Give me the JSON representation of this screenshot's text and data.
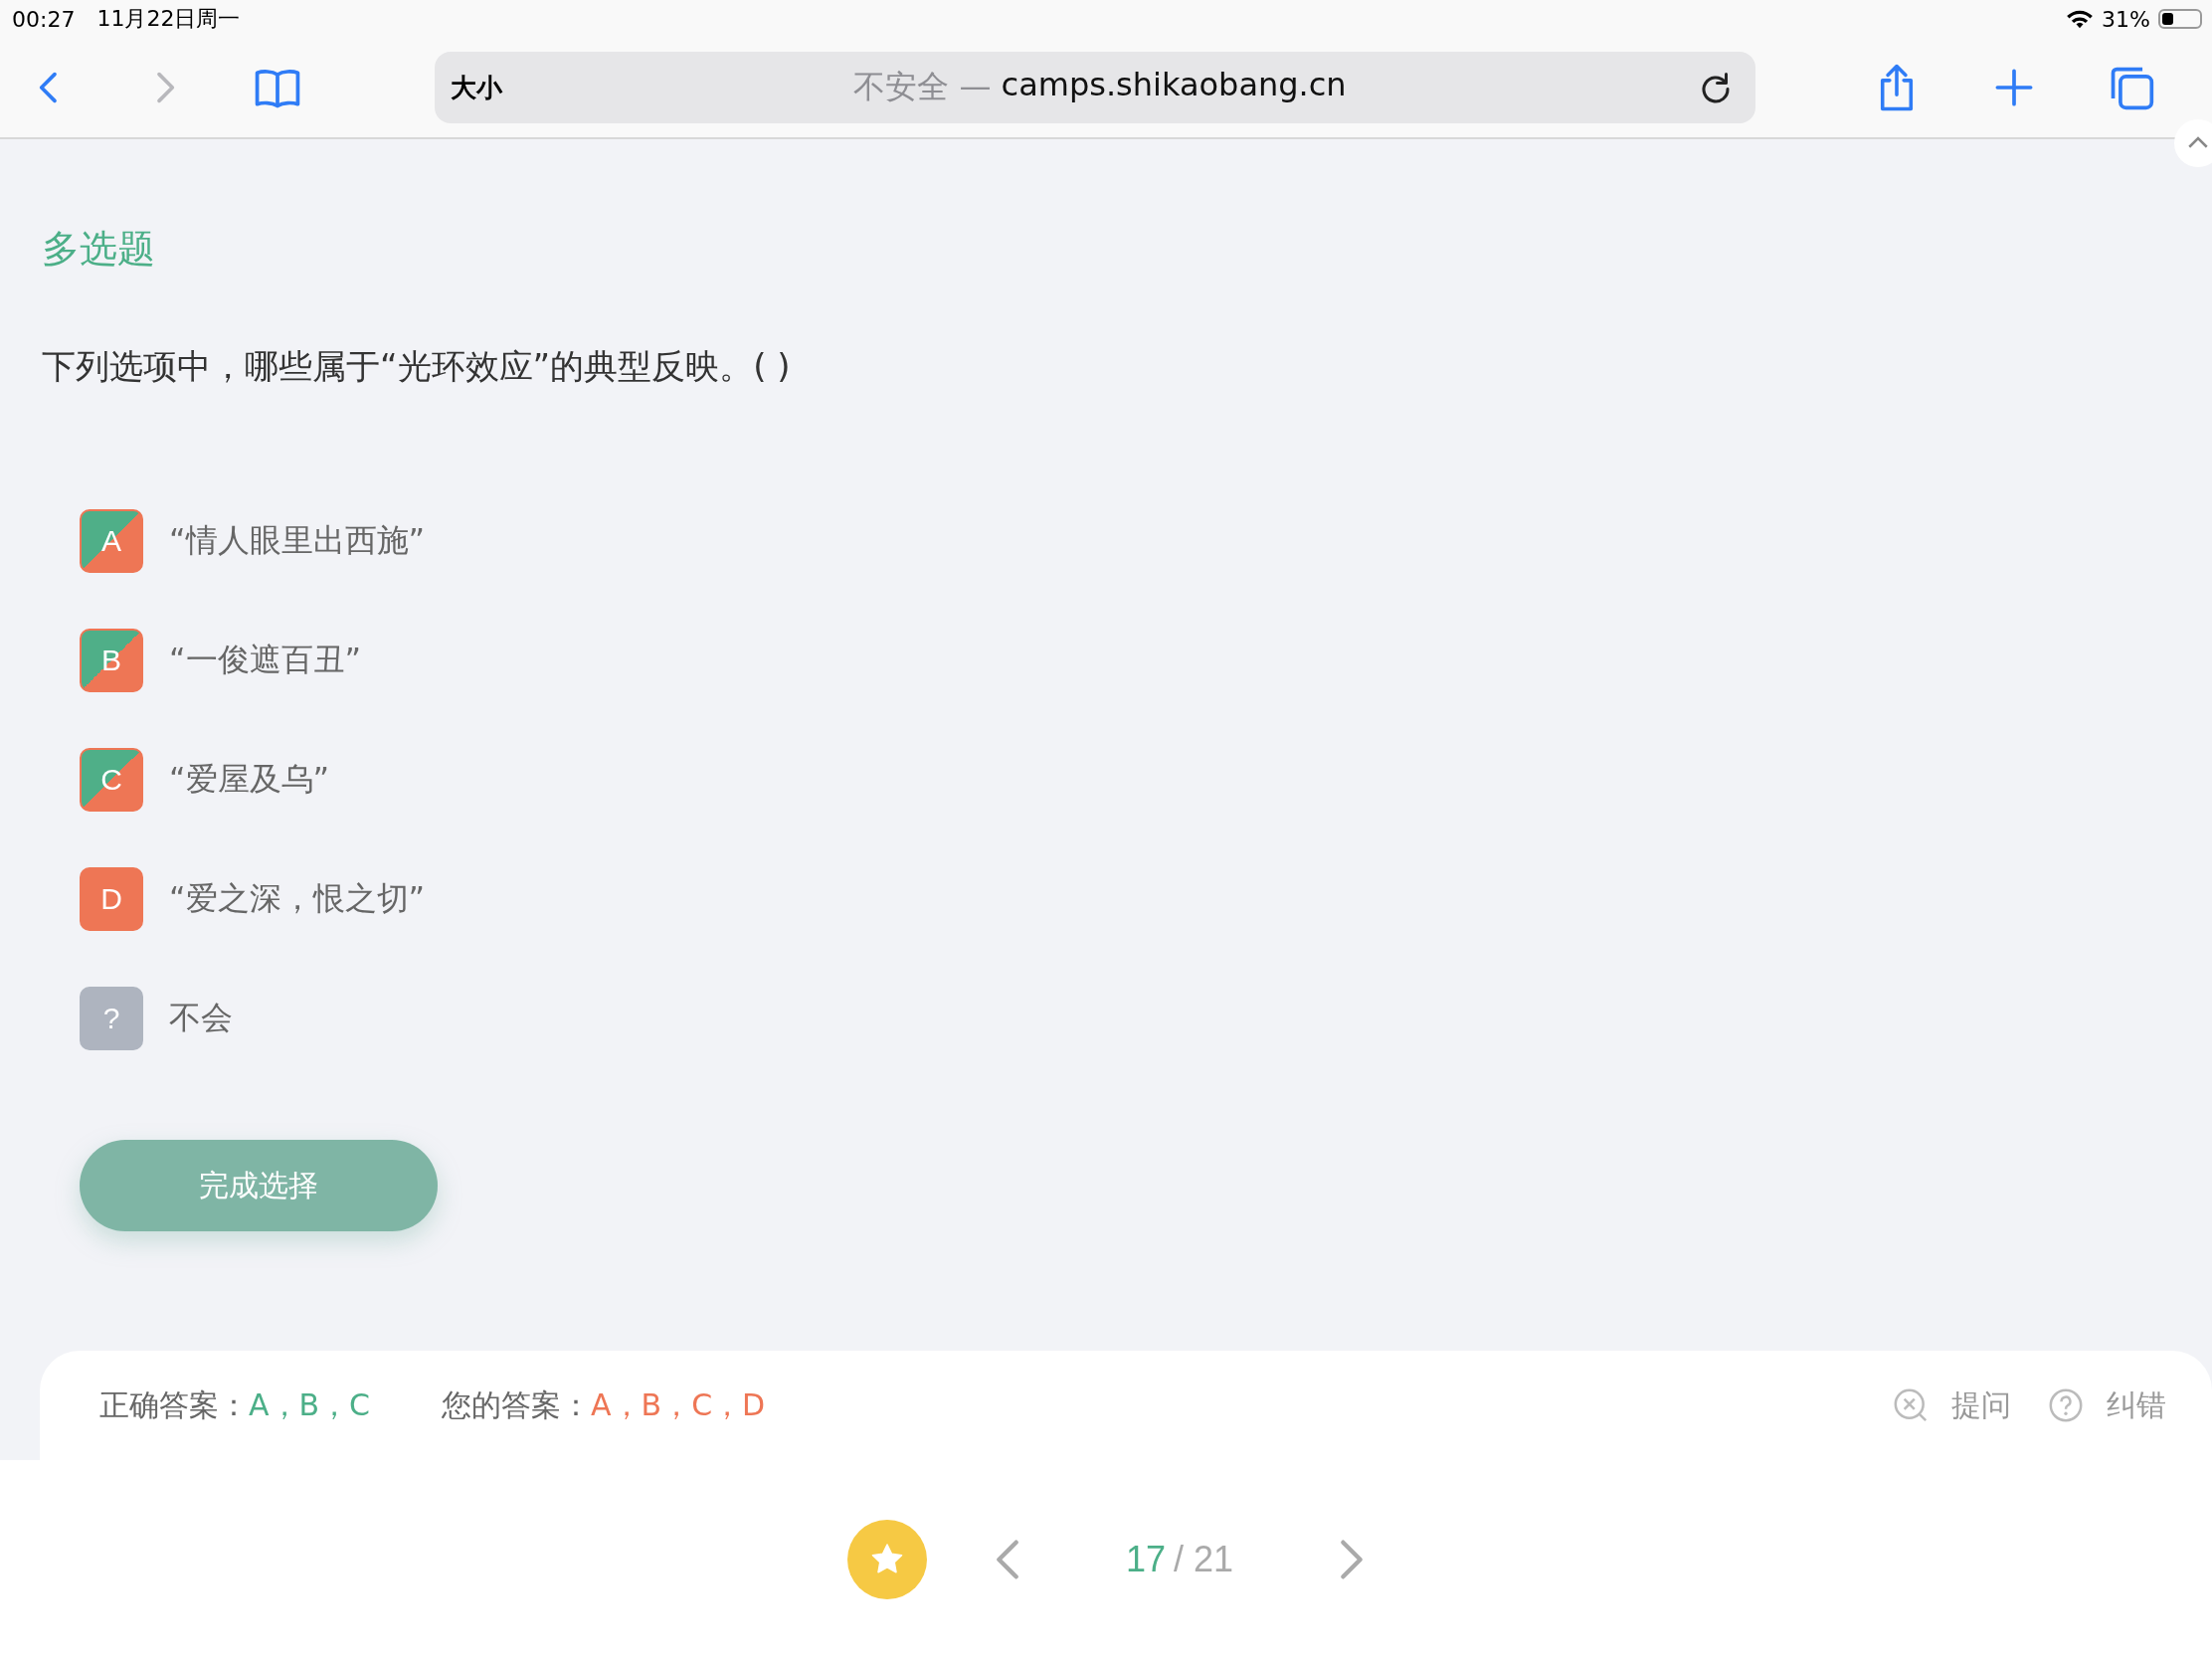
{
  "status_bar": {
    "time": "00:27",
    "date": "11月22日周一",
    "battery": "31%"
  },
  "browser": {
    "text_size": "大小",
    "security": "不安全 —",
    "url": "camps.shikaobang.cn"
  },
  "question": {
    "type": "多选题",
    "text": "下列选项中，哪些属于“光环效应”的典型反映。( )"
  },
  "options": [
    {
      "kind": "letter",
      "key": "A",
      "text": "“情人眼里出西施”",
      "correct": true,
      "chosen": true
    },
    {
      "kind": "letter",
      "key": "B",
      "text": "“一俊遮百丑”",
      "correct": true,
      "chosen": true
    },
    {
      "kind": "letter",
      "key": "C",
      "text": "“爱屋及乌”",
      "correct": true,
      "chosen": true
    },
    {
      "kind": "letter",
      "key": "D",
      "text": "“爱之深，恨之切”",
      "correct": false,
      "chosen": true
    },
    {
      "kind": "unknown",
      "key": "?",
      "text": "不会"
    }
  ],
  "submit_button": "完成选择",
  "answers": [
    {
      "kind": "correct",
      "label": "正确答案：",
      "value": "A，B，C"
    },
    {
      "kind": "yours",
      "label": "您的答案：",
      "value": "A，B，C，D"
    }
  ],
  "actions": [
    {
      "kind": "ask",
      "label": "提问"
    },
    {
      "kind": "report",
      "label": "纠错"
    }
  ],
  "pager": {
    "current": "17",
    "total": "/ 21"
  }
}
